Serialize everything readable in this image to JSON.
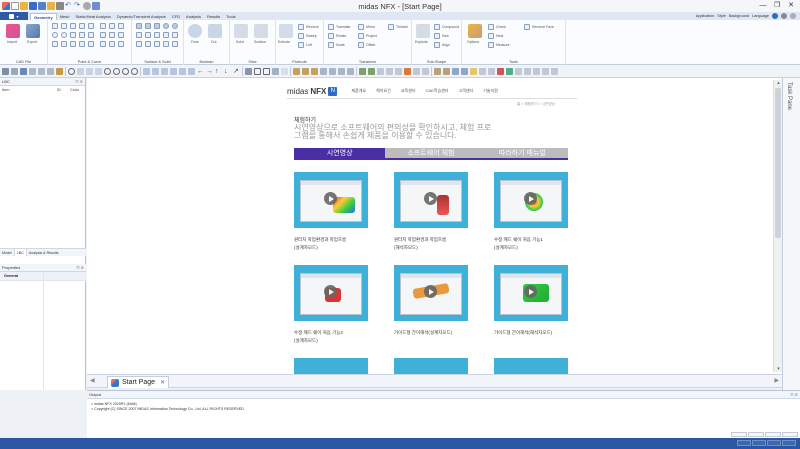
{
  "window": {
    "title": "midas NFX - [Start Page]",
    "minimize": "—",
    "maximize": "❐",
    "close": "✕"
  },
  "ribbon_tabs": [
    "Geometry",
    "Mesh",
    "Static/Heat Analysis",
    "Dynamic/Transient Analysis",
    "CFD",
    "Analysis",
    "Results",
    "Tools"
  ],
  "ribbon_right": {
    "app": "Application",
    "style": "Style",
    "background": "Background",
    "language": "Language"
  },
  "ribbon_groups": [
    {
      "label": "CAD File",
      "items": [
        "Import",
        "Export"
      ]
    },
    {
      "label": "Point & Curve",
      "items": []
    },
    {
      "label": "Surface & Solid",
      "items": []
    },
    {
      "label": "Boolean",
      "items": [
        "Fuse",
        "Cut"
      ]
    },
    {
      "label": "Slice",
      "items": [
        "Solid",
        "Surface"
      ]
    },
    {
      "label": "Protrude",
      "items": [
        "Extrude",
        "Revolve",
        "Sweep",
        "Loft"
      ]
    },
    {
      "label": "Transform",
      "items": [
        "Translate",
        "Rotate",
        "Scale",
        "Mirror",
        "Project",
        "Offset",
        "Thicken"
      ]
    },
    {
      "label": "Sub-Shape",
      "items": [
        "Explode",
        "Compound",
        "Sew",
        "Align"
      ]
    },
    {
      "label": "Tools",
      "items": [
        "Options",
        "Check",
        "Heal",
        "Measure",
        "Remove Face"
      ]
    }
  ],
  "left_panel": {
    "title": "LBC",
    "columns": [
      "Item",
      "ID",
      "Color"
    ],
    "tabs": [
      "Model",
      "LBC",
      "Analysis & Results"
    ],
    "properties_title": "Properties",
    "general": "General"
  },
  "right_panel": {
    "label": "Task Pane"
  },
  "start_page": {
    "logo_text": "midas",
    "logo_bold": "NFX",
    "nav": [
      "제품개요",
      "해석요건",
      "교육센터",
      "CAE학습센터",
      "고객센터",
      "기술지원"
    ],
    "breadcrumb": "홈 > 체험하기 > 시연영상",
    "heading": "체험하기",
    "subtitle": "시연영상으로 소프트웨어의 편의성을 확인하시고, 체험 프로그램을 통해서 손쉽게 제품을 이용할 수 있습니다.",
    "tabs": [
      "시연영상",
      "소프트웨어 체험",
      "따라하기 매뉴얼"
    ],
    "cards": [
      {
        "title": "원터치 학업환경과 학업흐름\n(설계자모드)"
      },
      {
        "title": "원터치 학업환경과 학업흐름\n(해석자모드)"
      },
      {
        "title": "수정 캐드 쉐이 처음 기능1\n(설계자모드)"
      },
      {
        "title": "수정 캐드 쉐이 처음 기능2\n(설계자모드)"
      },
      {
        "title": "가이드형 간이해석(설계자모드)"
      },
      {
        "title": "가이드형 간이해석(해석자모드)"
      }
    ]
  },
  "document_tab": {
    "label": "Start Page",
    "close": "✕"
  },
  "output": {
    "title": "Output",
    "lines": [
      "> midas NFX 2020R1 (64bit)",
      "> Copyright (C) SINCE 2007 MIDAS Information Technology Co., Ltd. ALL RIGHTS RESERVED."
    ]
  },
  "colors": {
    "accent": "#4a2ea6",
    "status": "#2a56a3",
    "thumb": "#3fb1d9"
  }
}
